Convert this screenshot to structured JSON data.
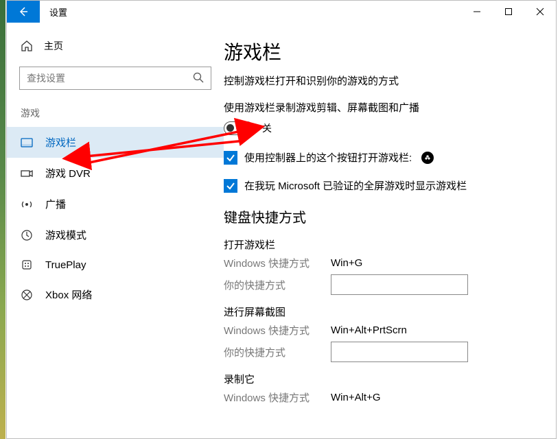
{
  "titlebar": {
    "title": "设置"
  },
  "sidebar": {
    "home": "主页",
    "search_placeholder": "查找设置",
    "group": "游戏",
    "items": [
      {
        "label": "游戏栏"
      },
      {
        "label": "游戏 DVR"
      },
      {
        "label": "广播"
      },
      {
        "label": "游戏模式"
      },
      {
        "label": "TruePlay"
      },
      {
        "label": "Xbox 网络"
      }
    ]
  },
  "main": {
    "heading": "游戏栏",
    "description": "控制游戏栏打开和识别你的游戏的方式",
    "toggle_label": "使用游戏栏录制游戏剪辑、屏幕截图和广播",
    "toggle_state": "关",
    "check1": "使用控制器上的这个按钮打开游戏栏:",
    "check2": "在我玩 Microsoft 已验证的全屏游戏时显示游戏栏",
    "shortcuts_heading": "键盘快捷方式",
    "windows_shortcut_label": "Windows 快捷方式",
    "your_shortcut_label": "你的快捷方式",
    "groups": [
      {
        "title": "打开游戏栏",
        "value": "Win+G"
      },
      {
        "title": "进行屏幕截图",
        "value": "Win+Alt+PrtScrn"
      },
      {
        "title": "录制它",
        "value": "Win+Alt+G"
      }
    ]
  }
}
